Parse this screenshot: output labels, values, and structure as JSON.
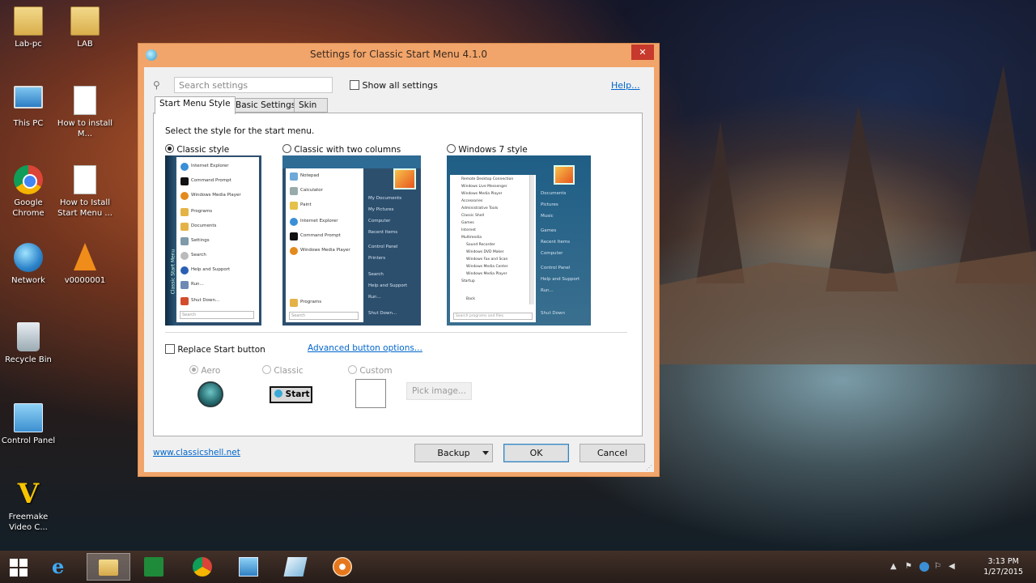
{
  "desktop": {
    "icons": [
      {
        "label": "Lab-pc",
        "icon": "user-folder-icon"
      },
      {
        "label": "LAB",
        "icon": "folder-icon"
      },
      {
        "label": "This PC",
        "icon": "computer-icon"
      },
      {
        "label": "How to install M...",
        "icon": "document-icon"
      },
      {
        "label": "Google Chrome",
        "icon": "chrome-icon"
      },
      {
        "label": "How to Istall Start Menu ...",
        "icon": "document-icon"
      },
      {
        "label": "Network",
        "icon": "network-icon"
      },
      {
        "label": "v0000001",
        "icon": "vlc-icon"
      },
      {
        "label": "Recycle Bin",
        "icon": "recycle-bin-icon"
      },
      {
        "label": "Control Panel",
        "icon": "control-panel-icon"
      },
      {
        "label": "Freemake Video C...",
        "icon": "freemake-icon"
      }
    ]
  },
  "window": {
    "title": "Settings for Classic Start Menu 4.1.0",
    "close_label": "✕",
    "search": {
      "placeholder": "Search settings",
      "value": ""
    },
    "show_all_label": "Show all settings",
    "help_label": "Help...",
    "tabs": [
      {
        "label": "Start Menu Style",
        "active": true
      },
      {
        "label": "Basic Settings",
        "active": false
      },
      {
        "label": "Skin",
        "active": false
      }
    ],
    "instruction": "Select the style for the start menu.",
    "styles": [
      {
        "label": "Classic style",
        "selected": true
      },
      {
        "label": "Classic with two columns",
        "selected": false
      },
      {
        "label": "Windows 7 style",
        "selected": false
      }
    ],
    "previews": {
      "classic": {
        "items": [
          "Internet Explorer",
          "Command Prompt",
          "Windows Media Player",
          "Programs",
          "Documents",
          "Settings",
          "Search",
          "Help and Support",
          "Run...",
          "Shut Down..."
        ],
        "side_label": "Classic Start Menu",
        "search_placeholder": "Search"
      },
      "two_columns": {
        "left_items": [
          "Notepad",
          "Calculator",
          "Paint",
          "Internet Explorer",
          "Command Prompt",
          "Windows Media Player",
          "Programs"
        ],
        "right_items": [
          "My Documents",
          "My Pictures",
          "Computer",
          "Recent Items",
          "Control Panel",
          "Printers",
          "Search",
          "Help and Support",
          "Run...",
          "Shut Down..."
        ],
        "search_placeholder": "Search"
      },
      "win7": {
        "left_items": [
          "Remote Desktop Connection",
          "Windows Live Messenger",
          "Windows Media Player",
          "Accessories",
          "Administrative Tools",
          "Classic Shell",
          "Games",
          "Internet",
          "Multimedia",
          "Sound Recorder",
          "Windows DVD Maker",
          "Windows Fax and Scan",
          "Windows Media Center",
          "Windows Media Player",
          "Startup",
          "Back"
        ],
        "right_items": [
          "Documents",
          "Pictures",
          "Music",
          "Games",
          "Recent Items",
          "Computer",
          "Control Panel",
          "Help and Support",
          "Run...",
          "Shut Down"
        ],
        "search_placeholder": "Search programs and files"
      }
    },
    "replace_start_label": "Replace Start button",
    "advanced_link": "Advanced button options...",
    "button_styles": [
      {
        "label": "Aero",
        "selected": true
      },
      {
        "label": "Classic",
        "selected": false
      },
      {
        "label": "Custom",
        "selected": false
      }
    ],
    "classic_start_label": "Start",
    "pick_image_label": "Pick image...",
    "site_link": "www.classicshell.net",
    "backup_label": "Backup",
    "ok_label": "OK",
    "cancel_label": "Cancel"
  },
  "taskbar": {
    "items": [
      "internet-explorer-icon",
      "file-explorer-icon",
      "excel-icon",
      "chrome-icon",
      "remote-desktop-icon",
      "paint-icon",
      "classic-shell-icon"
    ],
    "active_item": "file-explorer-icon",
    "clock_time": "3:13 PM",
    "clock_date": "1/27/2015"
  },
  "colors": {
    "window_frame": "#f2a56a",
    "close_button": "#c7392c",
    "link": "#0066cc",
    "preview_blue": "#2d4f6e"
  }
}
